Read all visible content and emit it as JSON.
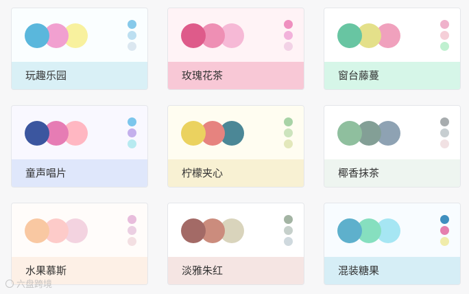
{
  "palettes": [
    {
      "name": "玩趣乐园",
      "top_bg": "#fafeff",
      "bottom_bg": "#d9f0f6",
      "big": [
        "#5ab7dc",
        "#f1a0d0",
        "#f8f19e"
      ],
      "small": [
        "#86c9ea",
        "#bcdff1",
        "#dbe7f0"
      ]
    },
    {
      "name": "玫瑰花茶",
      "top_bg": "#fff3f6",
      "bottom_bg": "#f8c8d6",
      "big": [
        "#de5b8a",
        "#ee8fb4",
        "#f6b9d6"
      ],
      "small": [
        "#ef8fbf",
        "#f2b2db",
        "#f2d2e6"
      ]
    },
    {
      "name": "窗台藤蔓",
      "top_bg": "#ffffff",
      "bottom_bg": "#d6f6e8",
      "big": [
        "#68c5a2",
        "#e4e08a",
        "#f0a1bd"
      ],
      "small": [
        "#efb2cb",
        "#f5cfd8",
        "#bff0d0"
      ]
    },
    {
      "name": "童声唱片",
      "top_bg": "#f9f8ff",
      "bottom_bg": "#dfe7fb",
      "big": [
        "#3b569f",
        "#e67cb4",
        "#ffb7c2"
      ],
      "small": [
        "#7cc6ec",
        "#c4b0ec",
        "#b7eaf0"
      ]
    },
    {
      "name": "柠檬夹心",
      "top_bg": "#fffdf1",
      "bottom_bg": "#f8f1d3",
      "big": [
        "#ebd25f",
        "#e6837f",
        "#4b8796"
      ],
      "small": [
        "#a8d3a6",
        "#cce4bd",
        "#e3e8bb"
      ]
    },
    {
      "name": "椰香抹茶",
      "top_bg": "#ffffff",
      "bottom_bg": "#eef5f0",
      "big": [
        "#8fbf9e",
        "#839f96",
        "#8ea2b3"
      ],
      "small": [
        "#a7acae",
        "#c7ced1",
        "#f1e1e3"
      ]
    },
    {
      "name": "水果慕斯",
      "top_bg": "#fffcfa",
      "bottom_bg": "#fdf0e6",
      "big": [
        "#f9c8a2",
        "#fdcbc9",
        "#f3d3e0"
      ],
      "small": [
        "#e8bddc",
        "#ebcfe2",
        "#f3dfe2"
      ]
    },
    {
      "name": "淡雅朱红",
      "top_bg": "#ffffff",
      "bottom_bg": "#f5e5e3",
      "big": [
        "#a36a66",
        "#cb8c7d",
        "#d9d4bc"
      ],
      "small": [
        "#a3b4a3",
        "#c6d0cb",
        "#cfd9de"
      ]
    },
    {
      "name": "混装糖果",
      "top_bg": "#f8fcff",
      "bottom_bg": "#d6eef6",
      "big": [
        "#5eb0cc",
        "#86dfbf",
        "#a6e6f3"
      ],
      "small": [
        "#3f8fbf",
        "#e57fae",
        "#f0ecaa"
      ]
    }
  ],
  "watermark": {
    "text": "六盘跨境"
  }
}
